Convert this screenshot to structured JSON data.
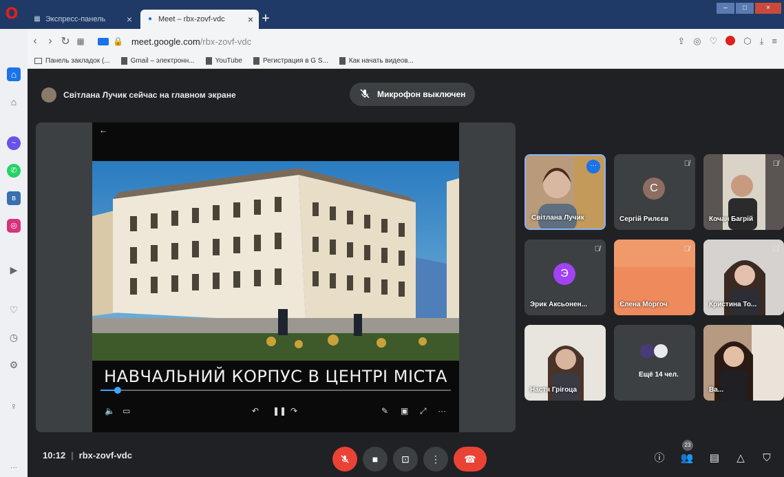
{
  "browser": {
    "tabs": [
      {
        "label": "Экспресс-панель"
      },
      {
        "label": "Meet – rbx-zovf-vdc"
      }
    ],
    "new_tab": "+",
    "url_host": "meet.google.com",
    "url_path": "/rbx-zovf-vdc",
    "bookmarks": [
      {
        "label": "Панель закладок (..."
      },
      {
        "label": "Gmail – электронн..."
      },
      {
        "label": "YouTube"
      },
      {
        "label": "Регистрация в G S..."
      },
      {
        "label": "Как начать видеов..."
      }
    ]
  },
  "meet": {
    "presenter_text": "Світлана Лучик сейчас на главном экране",
    "mic_toast": "Микрофон выключен",
    "caption": "НАВЧАЛЬНИЙ КОРПУС В ЦЕНТРІ МІСТА",
    "video_progress": 0.05,
    "participants": [
      {
        "name": "Світлана Лучик",
        "type": "photo"
      },
      {
        "name": "Сергій Рилєєв",
        "type": "letter",
        "letter": "C",
        "color": "#8d6e63"
      },
      {
        "name": "Кочан Багрій",
        "type": "photo"
      },
      {
        "name": "Эрик Аксьонен...",
        "type": "letter",
        "letter": "Э",
        "color": "#a142f4"
      },
      {
        "name": "Єлена Моргоч",
        "type": "photo"
      },
      {
        "name": "Кристина То...",
        "type": "photo"
      },
      {
        "name": "Настя Грігоца",
        "type": "photo"
      },
      {
        "name": "Ещё 14 чел.",
        "type": "more"
      },
      {
        "name": "Ва...",
        "type": "photo"
      }
    ],
    "clock": "10:12",
    "meeting_code": "rbx-zovf-vdc",
    "participants_count": "23",
    "colors": {
      "accent": "#1a73e8",
      "danger": "#ea4335",
      "surface": "#3c4043",
      "background": "#202124"
    }
  }
}
